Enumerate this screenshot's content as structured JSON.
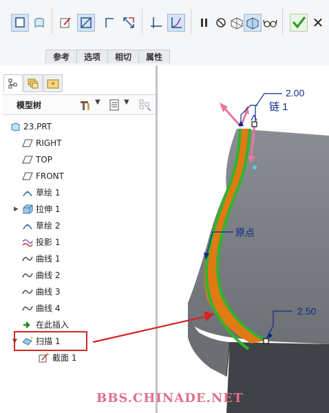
{
  "ribbon": {
    "tabs": [
      "参考",
      "选项",
      "相切",
      "属性"
    ],
    "buttons": [
      "solid-sweep-icon",
      "surface-sweep-icon",
      "sketch-icon",
      "remove-material-icon",
      "thicken-icon",
      "constant-section-icon",
      "variable-section-icon",
      "plane-sketch-icon",
      "trajectory-icon"
    ],
    "pause_icon": "pause-icon",
    "confirm_icon": "check-icon",
    "cancel_icon": "close-icon"
  },
  "panel": {
    "title": "模型树",
    "tabs": [
      "model-tree-tab-icon",
      "layer-tree-tab-icon",
      "favorites-tab-icon"
    ]
  },
  "tree": {
    "items": [
      {
        "label": "23.PRT",
        "icon": "part-icon"
      },
      {
        "label": "RIGHT",
        "icon": "datum-plane-icon"
      },
      {
        "label": "TOP",
        "icon": "datum-plane-icon"
      },
      {
        "label": "FRONT",
        "icon": "datum-plane-icon"
      },
      {
        "label": "草绘 1",
        "icon": "sketch-feature-icon"
      },
      {
        "label": "拉伸 1",
        "icon": "extrude-icon"
      },
      {
        "label": "草绘 2",
        "icon": "sketch-feature-icon"
      },
      {
        "label": "投影 1",
        "icon": "projection-icon"
      },
      {
        "label": "曲线 1",
        "icon": "curve-icon"
      },
      {
        "label": "曲线 2",
        "icon": "curve-icon"
      },
      {
        "label": "曲线 3",
        "icon": "curve-icon"
      },
      {
        "label": "曲线 4",
        "icon": "curve-icon"
      },
      {
        "label": "在此插入",
        "icon": "insert-here-icon"
      },
      {
        "label": "扫描 1",
        "icon": "sweep-icon"
      },
      {
        "label": "截面 1",
        "icon": "section-icon"
      }
    ]
  },
  "viewport": {
    "dim_top": "2.00",
    "chain_label": "链 1",
    "origin_label": "原点",
    "dim_bottom": "2.50"
  },
  "watermark": "BBS.CHINADE.NET",
  "colors": {
    "trajectory": "#2fb52f",
    "sweep_surface": "#e07a14",
    "dimension": "#0a2a8a",
    "arrow": "#e8779f",
    "callout": "#d42424",
    "solid": "#6f7378"
  }
}
